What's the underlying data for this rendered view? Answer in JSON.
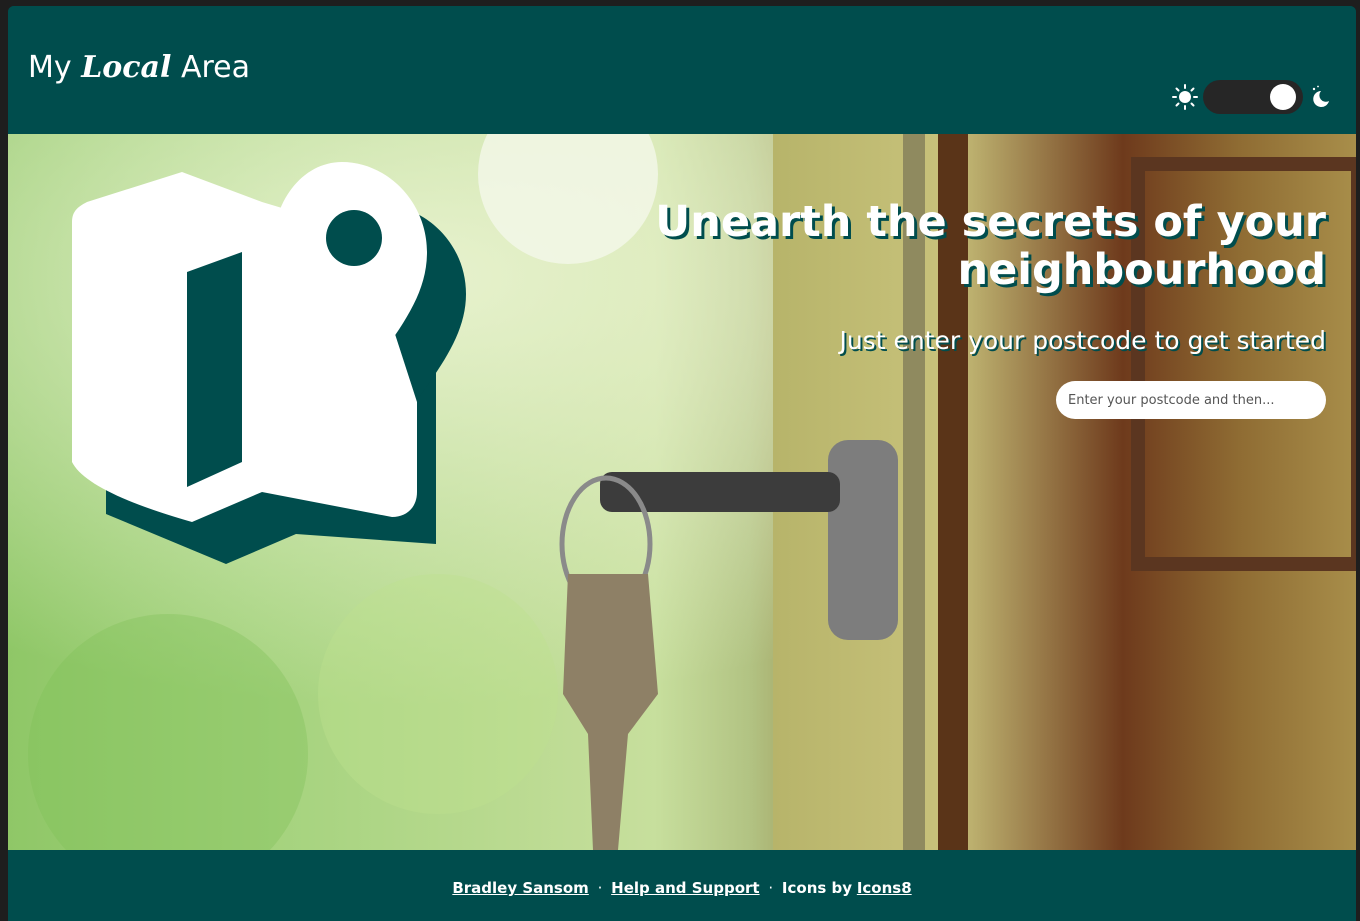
{
  "header": {
    "logo_part1": "My ",
    "logo_part2": "Local",
    "logo_part3": " Area",
    "theme_toggle": {
      "state": "dark",
      "left_icon": "sun-icon",
      "right_icon": "moon-icon"
    }
  },
  "hero": {
    "title": "Unearth the secrets of your neighbourhood",
    "subtitle": "Just enter your postcode to get started",
    "search": {
      "placeholder": "Enter your postcode and then...",
      "value": ""
    },
    "brand_icon": "map-pin-icon"
  },
  "footer": {
    "author_link": "Bradley Sansom",
    "separator": "·",
    "help_link": "Help and Support",
    "icons_prefix": "Icons by",
    "icons_link": "Icons8"
  },
  "colors": {
    "brand": "#004d4d",
    "toggle_track": "#262626",
    "text_light": "#ffffff"
  }
}
